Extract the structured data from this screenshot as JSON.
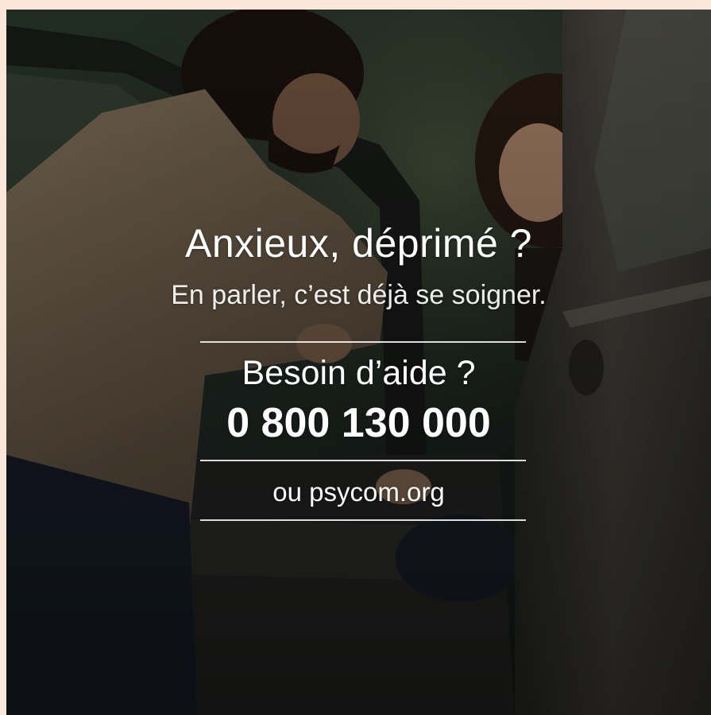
{
  "ad": {
    "headline": "Anxieux, déprimé ?",
    "subline": "En parler, c’est déjà se soigner.",
    "help_prompt": "Besoin d’aide ?",
    "phone_number": "0 800 130 000",
    "website": "ou psycom.org"
  },
  "colors": {
    "frame_background": "#fbe6da",
    "text": "#ffffff"
  }
}
